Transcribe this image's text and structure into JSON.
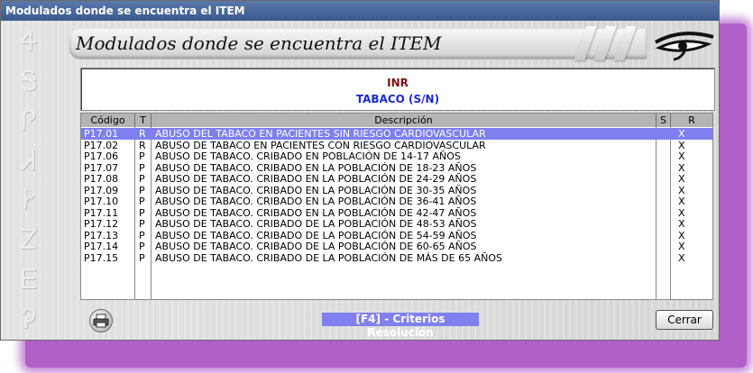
{
  "window": {
    "title": "Modulados donde se encuentra el ITEM"
  },
  "header": {
    "title": "Modulados donde se encuentra el ITEM",
    "decor_glyphs": [
      "Ꮞ",
      "Ꭶ",
      "Ꮅ",
      "Ꮧ",
      "Ꭸ",
      "Ꮓ",
      "Ꭼ",
      "Ꭾ"
    ]
  },
  "item": {
    "code": "INR",
    "name": "TABACO (S/N)"
  },
  "table": {
    "columns": {
      "code": "Código",
      "t": "T",
      "description": "Descripción",
      "s": "S",
      "r": "R"
    },
    "rows": [
      {
        "code": "P17.01",
        "t": "R",
        "description": "ABUSO DEL TABACO EN PACIENTES SIN RIESGO CARDIOVASCULAR",
        "s": "",
        "r": "X",
        "selected": true
      },
      {
        "code": "P17.02",
        "t": "R",
        "description": "ABUSO DE TABACO EN PACIENTES CON RIESGO CARDIOVASCULAR",
        "s": "",
        "r": "X"
      },
      {
        "code": "P17.06",
        "t": "P",
        "description": "ABUSO DE TABACO. CRIBADO EN POBLACIÓN DE 14-17 AÑOS",
        "s": "",
        "r": "X"
      },
      {
        "code": "P17.07",
        "t": "P",
        "description": "ABUSO DE TABACO. CRIBADO EN LA POBLACIÓN DE 18-23 AÑOS",
        "s": "",
        "r": "X"
      },
      {
        "code": "P17.08",
        "t": "P",
        "description": "ABUSO DE TABACO. CRIBADO EN LA POBLACIÓN DE 24-29 AÑOS",
        "s": "",
        "r": "X"
      },
      {
        "code": "P17.09",
        "t": "P",
        "description": "ABUSO DE TABACO. CRIBADO EN LA POBLACIÓN DE 30-35 AÑOS",
        "s": "",
        "r": "X"
      },
      {
        "code": "P17.10",
        "t": "P",
        "description": "ABUSO DE TABACO. CRIBADO EN LA POBLACIÓN DE 36-41 AÑOS",
        "s": "",
        "r": "X"
      },
      {
        "code": "P17.11",
        "t": "P",
        "description": "ABUSO DE TABACO. CRIBADO EN LA POBLACIÓN DE 42-47 AÑOS",
        "s": "",
        "r": "X"
      },
      {
        "code": "P17.12",
        "t": "P",
        "description": "ABUSO DE TABACO. CRIBADO DE LA POBLACIÓN DE 48-53 AÑOS",
        "s": "",
        "r": "X"
      },
      {
        "code": "P17.13",
        "t": "P",
        "description": "ABUSO DE TABACO. CRIBADO DE LA POBLACIÓN DE 54-59 AÑOS",
        "s": "",
        "r": "X"
      },
      {
        "code": "P17.14",
        "t": "P",
        "description": "ABUSO DE TABACO. CRIBADO DE LA POBLACIÓN DE 60-65 AÑOS",
        "s": "",
        "r": "X"
      },
      {
        "code": "P17.15",
        "t": "P",
        "description": "ABUSO DE TABACO. CRIBADO DE LA POBLACIÓN DE MÁS DE 65 AÑOS",
        "s": "",
        "r": "X"
      }
    ]
  },
  "footer": {
    "print_icon": "printer-icon",
    "f4_label": "[F4] - Criterios Resolución",
    "close_label": "Cerrar"
  },
  "colors": {
    "titlebar": "#3a5a90",
    "selection": "#7f7ff0",
    "item_code": "#7a1010",
    "item_name": "#1a2ad0",
    "shadow": "#b060c8"
  }
}
